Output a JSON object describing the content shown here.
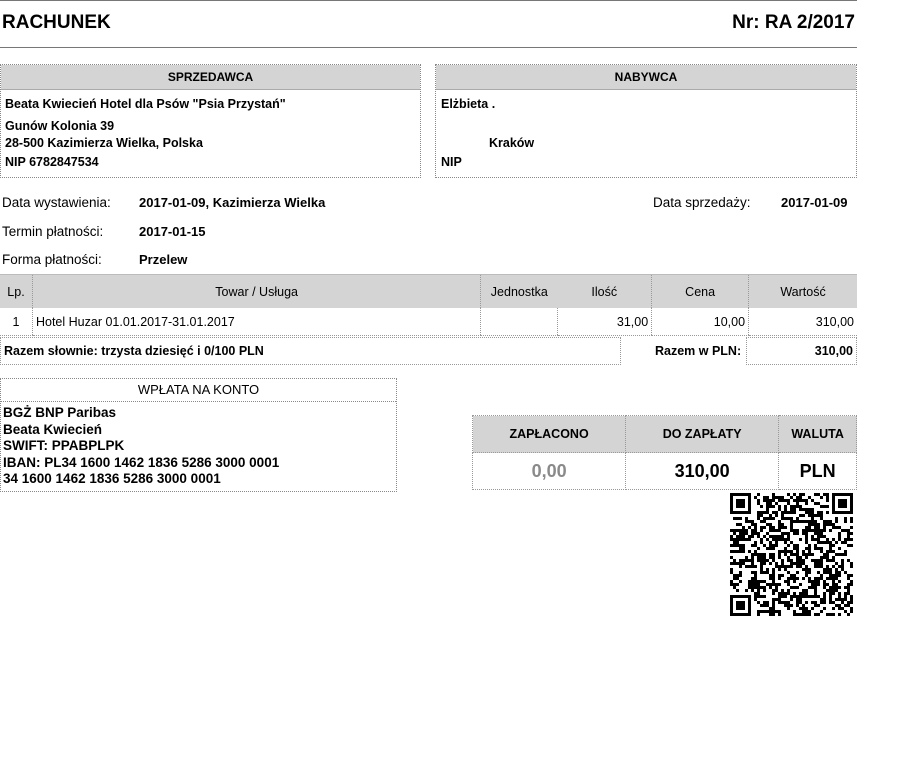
{
  "header": {
    "title": "RACHUNEK",
    "number": "Nr: RA 2/2017"
  },
  "seller": {
    "heading": "SPRZEDAWCA",
    "lines": [
      "Beata Kwiecień Hotel dla Psów \"Psia Przystań\"",
      "Gunów Kolonia 39",
      "28-500 Kazimierza Wielka, Polska",
      "NIP 6782847534"
    ]
  },
  "buyer": {
    "heading": "NABYWCA",
    "name": "Elżbieta .",
    "city": "Kraków",
    "nip": "NIP"
  },
  "meta": {
    "issue_label": "Data wystawienia:",
    "issue_value": "2017-01-09, Kazimierza Wielka",
    "due_label": "Termin płatności:",
    "due_value": "2017-01-15",
    "method_label": "Forma płatności:",
    "method_value": "Przelew",
    "sale_label": "Data sprzedaży:",
    "sale_value": "2017-01-09"
  },
  "items": {
    "headers": [
      "Lp.",
      "Towar / Usługa",
      "Jednostka",
      "Ilość",
      "Cena",
      "Wartość"
    ],
    "rows": [
      [
        "1",
        "Hotel Huzar 01.01.2017-31.01.2017",
        "",
        "31,00",
        "10,00",
        "310,00"
      ]
    ]
  },
  "summary": {
    "words": "Razem słownie: trzysta dziesięć i 0/100 PLN",
    "total_label": "Razem w PLN:",
    "total_value": "310,00"
  },
  "payment": {
    "heading": "WPŁATA NA KONTO",
    "lines": [
      "BGŻ BNP Paribas",
      "Beata Kwiecień",
      "SWIFT: PPABPLPK",
      "IBAN: PL34 1600 1462 1836 5286 3000 0001",
      "34 1600 1462 1836 5286 3000 0001"
    ]
  },
  "totals": {
    "paid_label": "ZAPŁACONO",
    "due_label": "DO ZAPŁATY",
    "currency_label": "WALUTA",
    "paid_value": "0,00",
    "due_value": "310,00",
    "currency_value": "PLN"
  },
  "qr": {
    "icon": "qr-code-icon"
  }
}
